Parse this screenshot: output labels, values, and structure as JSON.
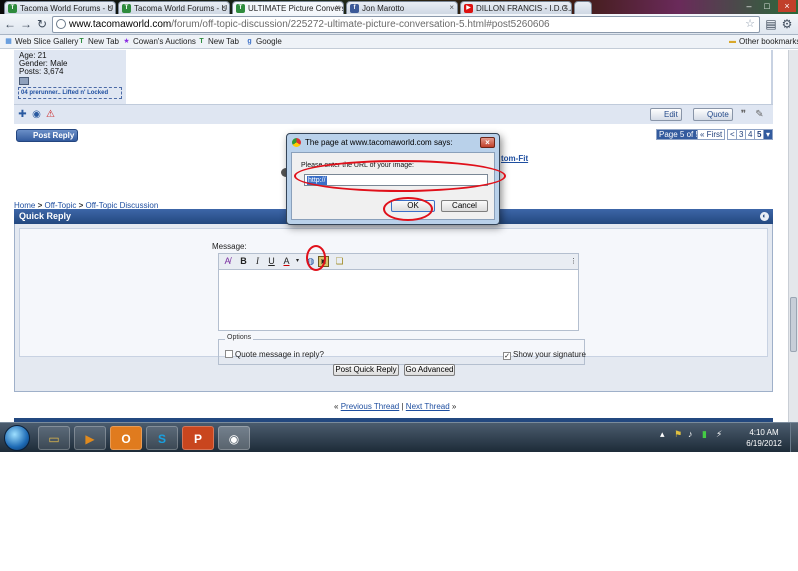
{
  "browser": {
    "tabs": [
      {
        "label": "Tacoma World Forums - U",
        "fav": "T"
      },
      {
        "label": "Tacoma World Forums - U",
        "fav": "T"
      },
      {
        "label": "ULTIMATE Picture Convers",
        "fav": "T"
      },
      {
        "label": "Jon Marotto",
        "fav": "f"
      },
      {
        "label": "DILLON FRANCIS - I.D.G.A.",
        "fav": "▶"
      }
    ],
    "url_host": "www.tacomaworld.com",
    "url_path": "/forum/off-topic-discussion/225272-ultimate-picture-conversation-5.html#post5260606",
    "bookmarks": [
      "Web Slice Gallery",
      "New Tab",
      "Cowan's Auctions",
      "New Tab",
      "Google"
    ],
    "other_bookmarks": "Other bookmarks"
  },
  "post": {
    "age": "Age: 21",
    "gender": "Gender: Male",
    "posts": "Posts: 3,674",
    "signature": "04 prerunner.. Lifted n' Locked",
    "edit_label": "Edit",
    "quote_label": "Quote"
  },
  "forum": {
    "post_reply": "Post Reply",
    "page_of": "Page 5 of 5",
    "first": "« First",
    "pages": [
      "<",
      "3",
      "4",
      "5"
    ],
    "current_page": "5",
    "partial_link": "tom-Fit",
    "breadcrumb": [
      "Home",
      "Off-Topic",
      "Off-Topic Discussion"
    ],
    "breadcrumb_sep": ">",
    "quick_reply": "Quick Reply",
    "message_label": "Message:",
    "options_label": "Options",
    "quote_in_reply": "Quote message in reply?",
    "show_signature": "Show your signature",
    "post_quick_reply": "Post Quick Reply",
    "go_advanced": "Go Advanced",
    "prev_thread": "Previous Thread",
    "next_thread": "Next Thread",
    "nav_sep": "|",
    "laquo": "«",
    "raquo": "»"
  },
  "dialog": {
    "title": "The page at www.tacomaworld.com says:",
    "message": "Please enter the URL of your image:",
    "input_value": "http://",
    "ok_label": "OK",
    "cancel_label": "Cancel"
  },
  "taskbar": {
    "time": "4:10 AM",
    "date": "6/19/2012"
  },
  "colors": {
    "annotation": "#e0101a",
    "forum_header": "#23487f",
    "dialog_frame": "#b9d1ea"
  }
}
